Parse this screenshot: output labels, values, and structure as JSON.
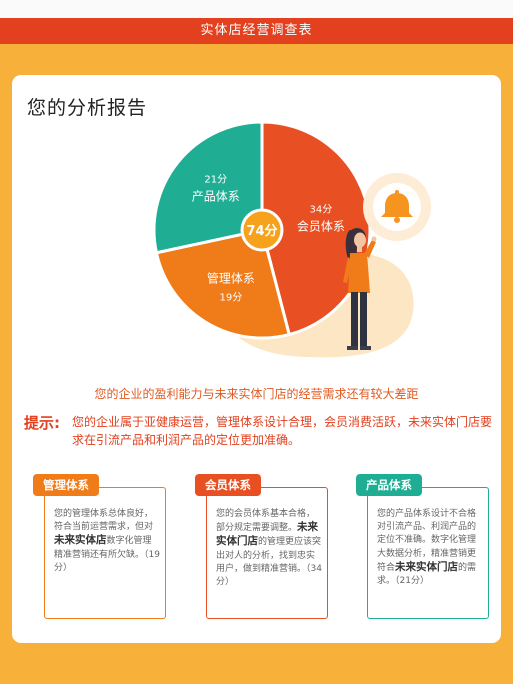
{
  "header": {
    "title": "实体店经营调查表"
  },
  "report": {
    "title": "您的分析报告"
  },
  "chart_data": {
    "type": "pie",
    "total_label": "74分",
    "slices": [
      {
        "name": "会员体系",
        "value": 34,
        "label": "34分",
        "color": "#e84f22"
      },
      {
        "name": "管理体系",
        "value": 19,
        "label": "19分",
        "color": "#ef7b19"
      },
      {
        "name": "产品体系",
        "value": 21,
        "label": "21分",
        "color": "#1fae94"
      }
    ],
    "center_color": "#f6a21d",
    "bell_color": "#f5941f"
  },
  "conclusion": "您的企业的盈利能力与未来实体门店的经营需求还有较大差距",
  "tip": {
    "label": "提示:",
    "text": "您的企业属于亚健康运营，管理体系设计合理，会员消费活跃，未来实体门店要求在引流产品和利润产品的定位更加准确。"
  },
  "boxes": [
    {
      "title": "管理体系",
      "color": "#ef7b19",
      "p1": "您的管理体系总体良好，符合当前运营需求，但对",
      "bold": "未来实体店",
      "p2": "数字化管理精准营销还有所欠缺。（19分）"
    },
    {
      "title": "会员体系",
      "color": "#e84f22",
      "p1": "您的会员体系基本合格，部分规定需要调整。",
      "bold": "未来实体门店",
      "p2": "的管理更应该突出对人的分析，找到忠实用户，做到精准营销。（34分）"
    },
    {
      "title": "产品体系",
      "color": "#1fae94",
      "p1": "您的产品体系设计不合格对引流产品、利润产品的定位不准确。数字化管理大数据分析，精准营销更符合",
      "bold": "未来实体门店",
      "p2": "的需求。（21分）"
    }
  ]
}
